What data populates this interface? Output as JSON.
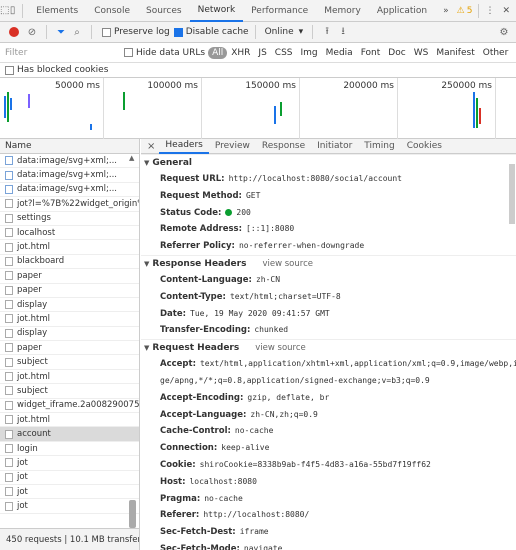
{
  "devtools": {
    "tabs": [
      "Elements",
      "Console",
      "Sources",
      "Network",
      "Performance",
      "Memory",
      "Application"
    ],
    "active_tab": "Network",
    "more_tabs": "»",
    "warnings_count": "5"
  },
  "network_toolbar": {
    "preserve_log": "Preserve log",
    "disable_cache": "Disable cache",
    "throttle": "Online",
    "throttle_arrow": "▾"
  },
  "filter_bar": {
    "placeholder": "Filter",
    "hide_data_urls": "Hide data URLs",
    "types": [
      "All",
      "XHR",
      "JS",
      "CSS",
      "Img",
      "Media",
      "Font",
      "Doc",
      "WS",
      "Manifest",
      "Other"
    ],
    "has_blocked_cookies": "Has blocked cookies"
  },
  "timeline": {
    "ticks": [
      "50000 ms",
      "100000 ms",
      "150000 ms",
      "200000 ms",
      "250000 ms"
    ]
  },
  "request_list": {
    "header": "Name",
    "items": [
      {
        "name": "data:image/svg+xml;...",
        "type": "img"
      },
      {
        "name": "data:image/svg+xml;...",
        "type": "img"
      },
      {
        "name": "data:image/svg+xml;...",
        "type": "img"
      },
      {
        "name": "jot?l=%7B%22widget_origin%",
        "type": "doc"
      },
      {
        "name": "settings",
        "type": "doc"
      },
      {
        "name": "localhost",
        "type": "doc"
      },
      {
        "name": "jot.html",
        "type": "doc"
      },
      {
        "name": "blackboard",
        "type": "doc"
      },
      {
        "name": "paper",
        "type": "doc"
      },
      {
        "name": "paper",
        "type": "doc"
      },
      {
        "name": "display",
        "type": "doc"
      },
      {
        "name": "jot.html",
        "type": "doc"
      },
      {
        "name": "display",
        "type": "doc"
      },
      {
        "name": "paper",
        "type": "doc"
      },
      {
        "name": "subject",
        "type": "doc"
      },
      {
        "name": "jot.html",
        "type": "doc"
      },
      {
        "name": "subject",
        "type": "doc"
      },
      {
        "name": "widget_iframe.2a0082900751",
        "type": "doc"
      },
      {
        "name": "jot.html",
        "type": "doc"
      },
      {
        "name": "account",
        "type": "doc",
        "selected": true
      },
      {
        "name": "login",
        "type": "doc"
      },
      {
        "name": "jot",
        "type": "doc"
      },
      {
        "name": "jot",
        "type": "doc"
      },
      {
        "name": "jot",
        "type": "doc"
      },
      {
        "name": "jot",
        "type": "doc"
      }
    ],
    "status": "450 requests  |  10.1 MB transferre"
  },
  "detail_tabs": {
    "close": "×",
    "tabs": [
      "Headers",
      "Preview",
      "Response",
      "Initiator",
      "Timing",
      "Cookies"
    ],
    "active": "Headers"
  },
  "general": {
    "title": "General",
    "rows": [
      {
        "k": "Request URL:",
        "v": "http://localhost:8080/social/account"
      },
      {
        "k": "Request Method:",
        "v": "GET"
      },
      {
        "k": "Status Code:",
        "v": "200",
        "dot": true
      },
      {
        "k": "Remote Address:",
        "v": "[::1]:8080"
      },
      {
        "k": "Referrer Policy:",
        "v": "no-referrer-when-downgrade"
      }
    ]
  },
  "response_headers": {
    "title": "Response Headers",
    "view_source": "view source",
    "rows": [
      {
        "k": "Content-Language:",
        "v": "zh-CN"
      },
      {
        "k": "Content-Type:",
        "v": "text/html;charset=UTF-8"
      },
      {
        "k": "Date:",
        "v": "Tue, 19 May 2020 09:41:57 GMT"
      },
      {
        "k": "Transfer-Encoding:",
        "v": "chunked"
      }
    ]
  },
  "request_headers": {
    "title": "Request Headers",
    "view_source": "view source",
    "rows": [
      {
        "k": "Accept:",
        "v": "text/html,application/xhtml+xml,application/xml;q=0.9,image/webp,ima"
      },
      {
        "k": "",
        "v": "ge/apng,*/*;q=0.8,application/signed-exchange;v=b3;q=0.9"
      },
      {
        "k": "Accept-Encoding:",
        "v": "gzip, deflate, br"
      },
      {
        "k": "Accept-Language:",
        "v": "zh-CN,zh;q=0.9"
      },
      {
        "k": "Cache-Control:",
        "v": "no-cache"
      },
      {
        "k": "Connection:",
        "v": "keep-alive"
      },
      {
        "k": "Cookie:",
        "v": "shiroCookie=8338b9ab-f4f5-4d83-a16a-55bd7f19ff62"
      },
      {
        "k": "Host:",
        "v": "localhost:8080"
      },
      {
        "k": "Pragma:",
        "v": "no-cache"
      },
      {
        "k": "Referer:",
        "v": "http://localhost:8080/"
      },
      {
        "k": "Sec-Fetch-Dest:",
        "v": "iframe"
      },
      {
        "k": "Sec-Fetch-Mode:",
        "v": "navigate"
      }
    ]
  },
  "colors": {
    "accent": "#1a73e8",
    "status_ok": "#0a9e30",
    "record": "#d93025"
  }
}
